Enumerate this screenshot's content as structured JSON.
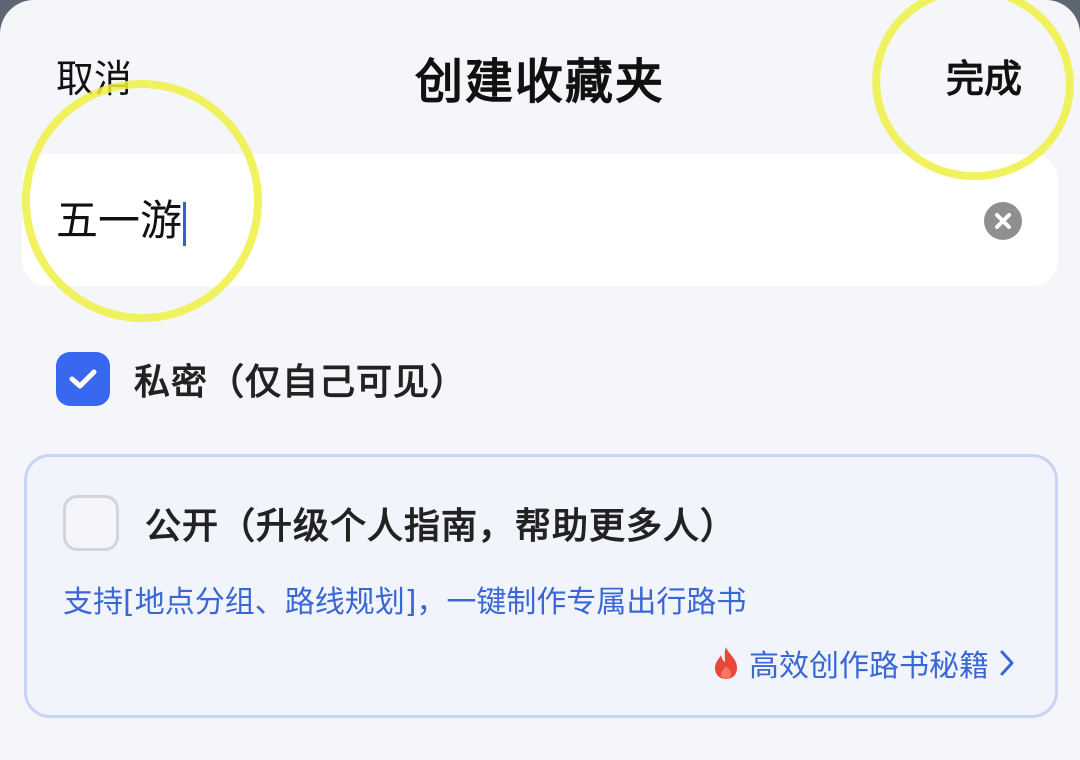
{
  "header": {
    "cancel_label": "取消",
    "title": "创建收藏夹",
    "done_label": "完成"
  },
  "name_field": {
    "value": "五一游"
  },
  "privacy": {
    "private_label": "私密（仅自己可见）",
    "private_checked": true,
    "public_label": "公开（升级个人指南，帮助更多人）",
    "public_checked": false
  },
  "public_card": {
    "promo": "支持[地点分组、路线规划]，一键制作专属出行路书",
    "tips_link": "高效创作路书秘籍"
  },
  "colors": {
    "accent": "#3a67f0",
    "link": "#3a67d6",
    "highlight": "#eef044",
    "flame": "#e8473a"
  },
  "icons": [
    "clear-icon",
    "checkmark-icon",
    "flame-icon",
    "chevron-right-icon"
  ]
}
